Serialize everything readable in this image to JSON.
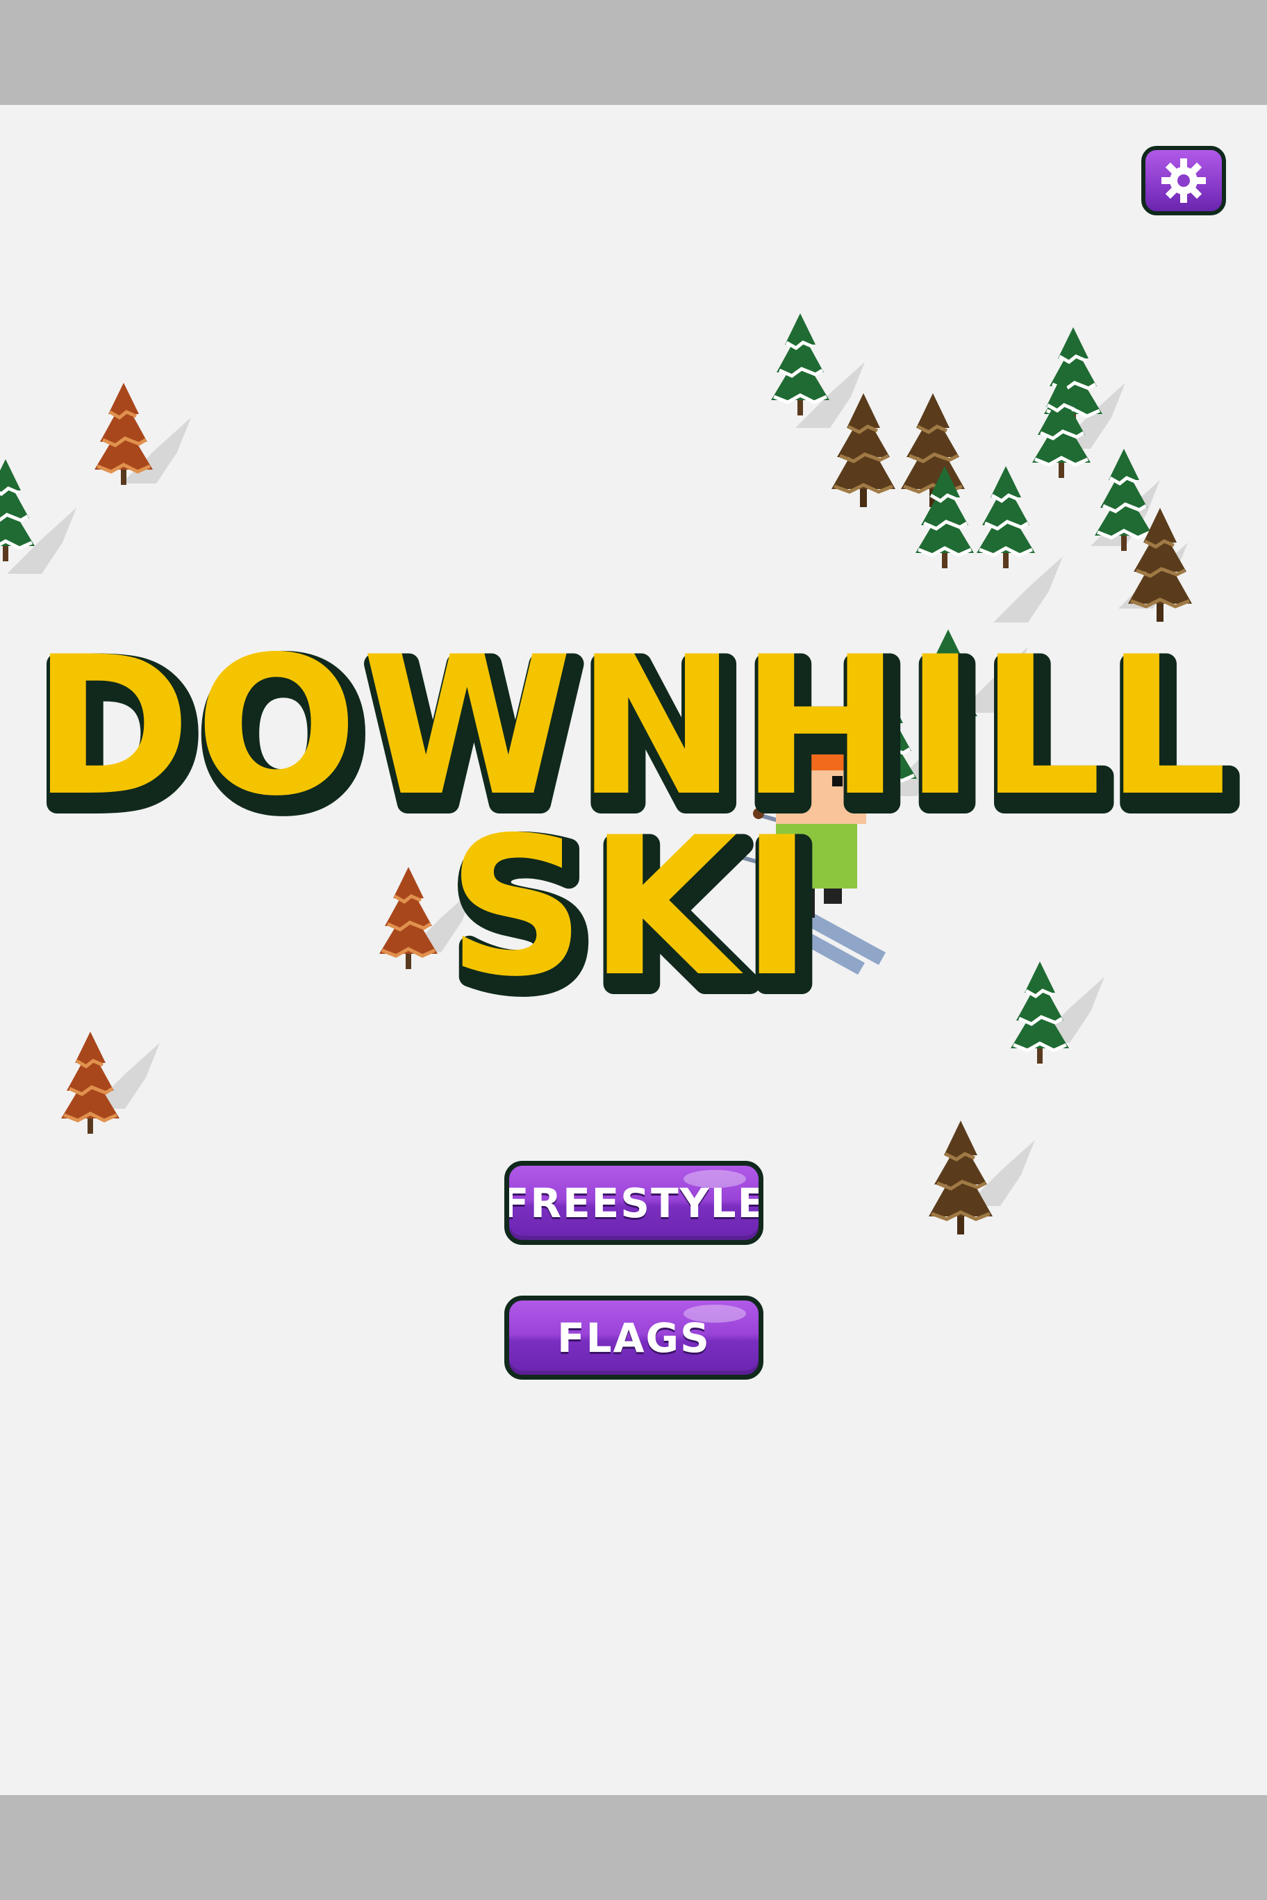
{
  "game": {
    "title_line1": "DOWNHILL",
    "title_line2": "SKI"
  },
  "menu": {
    "freestyle_label": "FREESTYLE",
    "flags_label": "FLAGS"
  },
  "settings": {
    "icon": "gear-icon"
  },
  "colors": {
    "title_fill": "#f5c400",
    "title_outline": "#10291c",
    "button_purple": "#8b3ccc",
    "snow": "#f2f2f2",
    "letterbox": "#b9b9b9"
  }
}
